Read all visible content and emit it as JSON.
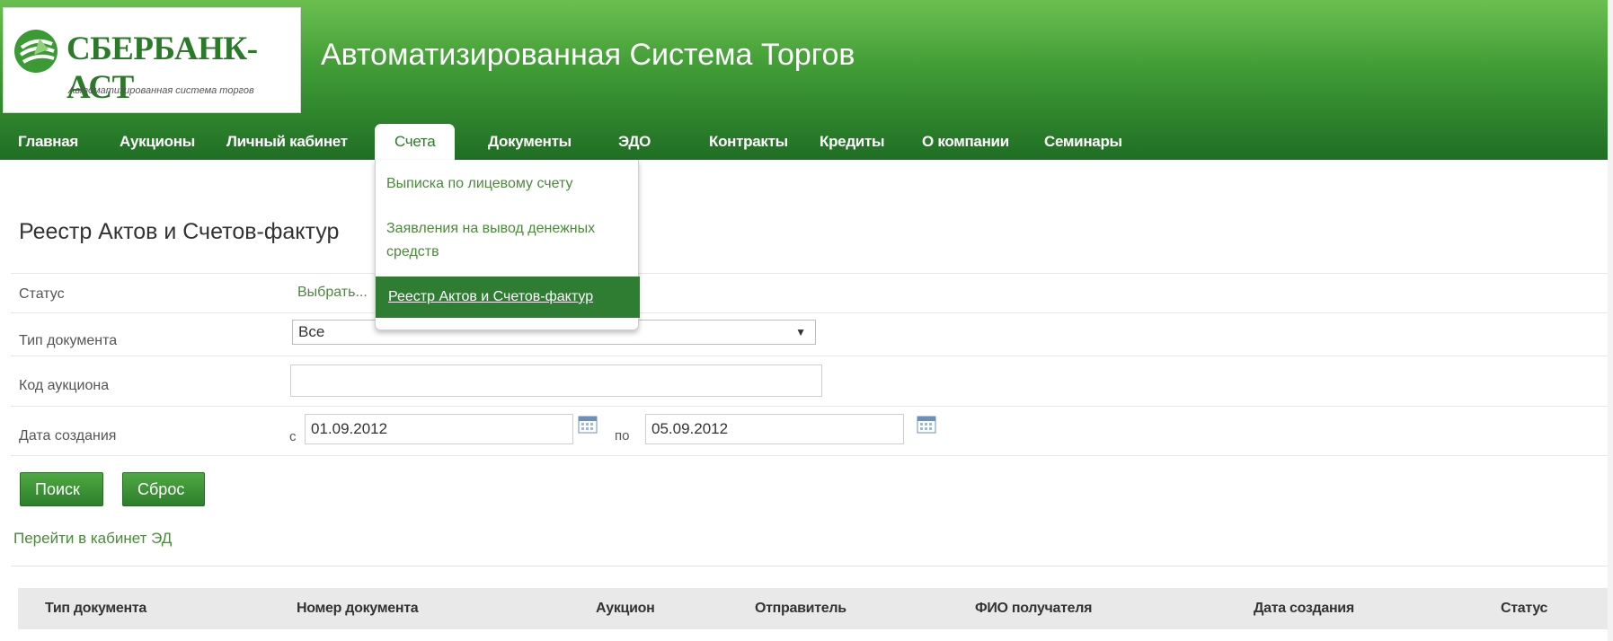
{
  "header": {
    "logo_name": "СБЕРБАНК-АСТ",
    "logo_subtitle": "Автоматизированная система торгов",
    "title": "Автоматизированная Система Торгов"
  },
  "nav": {
    "items": [
      {
        "label": "Главная"
      },
      {
        "label": "Аукционы"
      },
      {
        "label": "Личный кабинет"
      },
      {
        "label": "Счета",
        "active": true
      },
      {
        "label": "Документы"
      },
      {
        "label": "ЭДО"
      },
      {
        "label": "Контракты"
      },
      {
        "label": "Кредиты"
      },
      {
        "label": "О компании"
      },
      {
        "label": "Семинары"
      }
    ]
  },
  "dropdown": {
    "items": [
      {
        "label": "Выписка по лицевому счету"
      },
      {
        "label": "Заявления на вывод денежных средств"
      },
      {
        "label": "Реестр Актов и Счетов-фактур",
        "selected": true
      }
    ]
  },
  "page": {
    "title": "Реестр Актов и Счетов-фактур"
  },
  "form": {
    "status_label": "Статус",
    "status_link": "Выбрать...",
    "doc_type_label": "Тип документа",
    "doc_type_value": "Все",
    "auction_code_label": "Код аукциона",
    "auction_code_value": "",
    "created_label": "Дата создания",
    "from_prefix": "с",
    "date_from": "01.09.2012",
    "to_prefix": "по",
    "date_to": "05.09.2012"
  },
  "buttons": {
    "search": "Поиск",
    "reset": "Сброс"
  },
  "ed_link": "Перейти в кабинет ЭД",
  "table": {
    "columns": [
      "Тип документа",
      "Номер документа",
      "Аукцион",
      "Отправитель",
      "ФИО получателя",
      "Дата создания",
      "Статус"
    ]
  },
  "colors": {
    "brand_green": "#2e7d32",
    "link_green": "#4a8a3a"
  }
}
